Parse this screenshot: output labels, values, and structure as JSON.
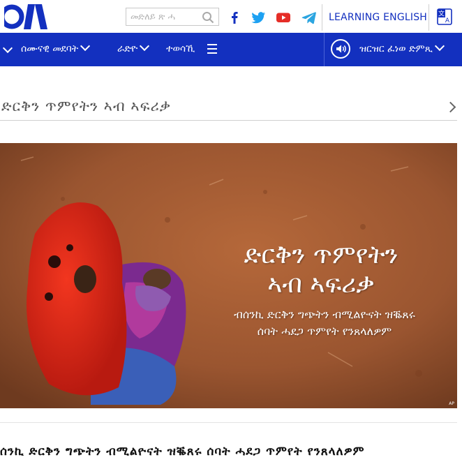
{
  "header": {
    "search_placeholder": "መድለይ ጽ ሓ",
    "learning_label": "LEARNING ENGLISH",
    "icons": [
      "logo-icon",
      "search-icon",
      "facebook-icon",
      "twitter-icon",
      "youtube-icon",
      "telegram-icon",
      "translate-icon"
    ],
    "colors": {
      "brand_blue": "#1330bf",
      "youtube_red": "#e52d27",
      "facebook": "#1877f2",
      "twitter": "#1da1f2",
      "telegram": "#2ca5e0"
    }
  },
  "nav": {
    "items": [
      {
        "label": "ሰሙናዊ መደባት"
      },
      {
        "label": "ራድዮ"
      },
      {
        "label": "ተወሳኺ"
      }
    ],
    "live_label": "ዝርዝር ፈነወ ድምጺ"
  },
  "section": {
    "title": "ድርቅን ጥምየትን ኣብ ኣፍሪቃ"
  },
  "hero": {
    "title_line1": "ድርቅን ጥምየትን",
    "title_line2": "ኣብ ኣፍሪቃ",
    "subtitle_line1": "ብሰንኪ ድርቅን ግጭትን ብሚልዮናት ዝቘጸሩ",
    "subtitle_line2": "ሰባት ሓደጋ ጥምየት የንጸላለዎም",
    "credit": "AP"
  },
  "article": {
    "headline": "ሰንኪ ድርቅን ግጭትን ብሚልዮናት ዝቘጸሩ ሰባት ሓደጋ ጥምየት የንጸላለዎም"
  }
}
